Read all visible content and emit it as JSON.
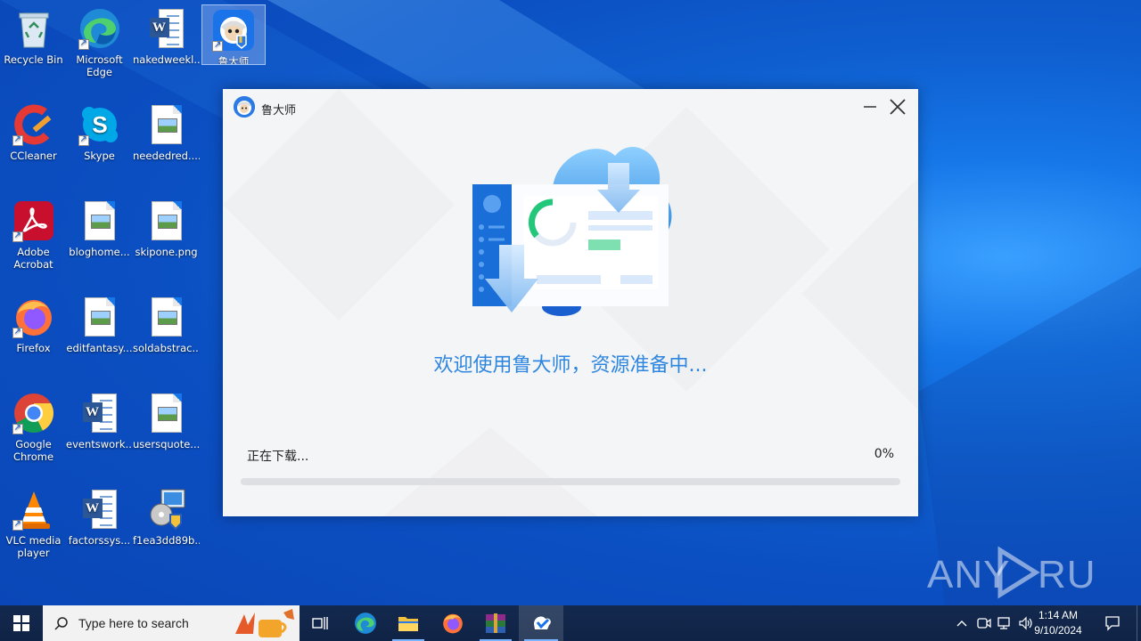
{
  "desktop": {
    "icons": [
      {
        "label": "Recycle Bin"
      },
      {
        "label": "Microsoft Edge"
      },
      {
        "label": "nakedweekl..."
      },
      {
        "label": "鲁大师"
      },
      {
        "label": "CCleaner"
      },
      {
        "label": "Skype"
      },
      {
        "label": "neededred...."
      },
      {
        "label": "Adobe Acrobat"
      },
      {
        "label": "bloghome..."
      },
      {
        "label": "skipone.png"
      },
      {
        "label": "Firefox"
      },
      {
        "label": "editfantasy..."
      },
      {
        "label": "soldabstrac..."
      },
      {
        "label": "Google Chrome"
      },
      {
        "label": "eventswork..."
      },
      {
        "label": "usersquote...."
      },
      {
        "label": "VLC media player"
      },
      {
        "label": "factorssys..."
      },
      {
        "label": "f1ea3dd89b..."
      }
    ]
  },
  "window": {
    "title": "鲁大师",
    "minimize_glyph": "—",
    "close_glyph": "✕",
    "welcome_text": "欢迎使用鲁大师，资源准备中...",
    "status_text": "正在下载...",
    "progress_percent_label": "0%",
    "progress_fraction": 0
  },
  "watermark": {
    "text": "ANY RUN"
  },
  "taskbar": {
    "search_placeholder": "Type here to search",
    "clock_time": "1:14 AM",
    "clock_date": "9/10/2024"
  },
  "colors": {
    "accent": "#2e86de",
    "desktop_blue": "#0b4fc2",
    "taskbar": "#13294d"
  }
}
